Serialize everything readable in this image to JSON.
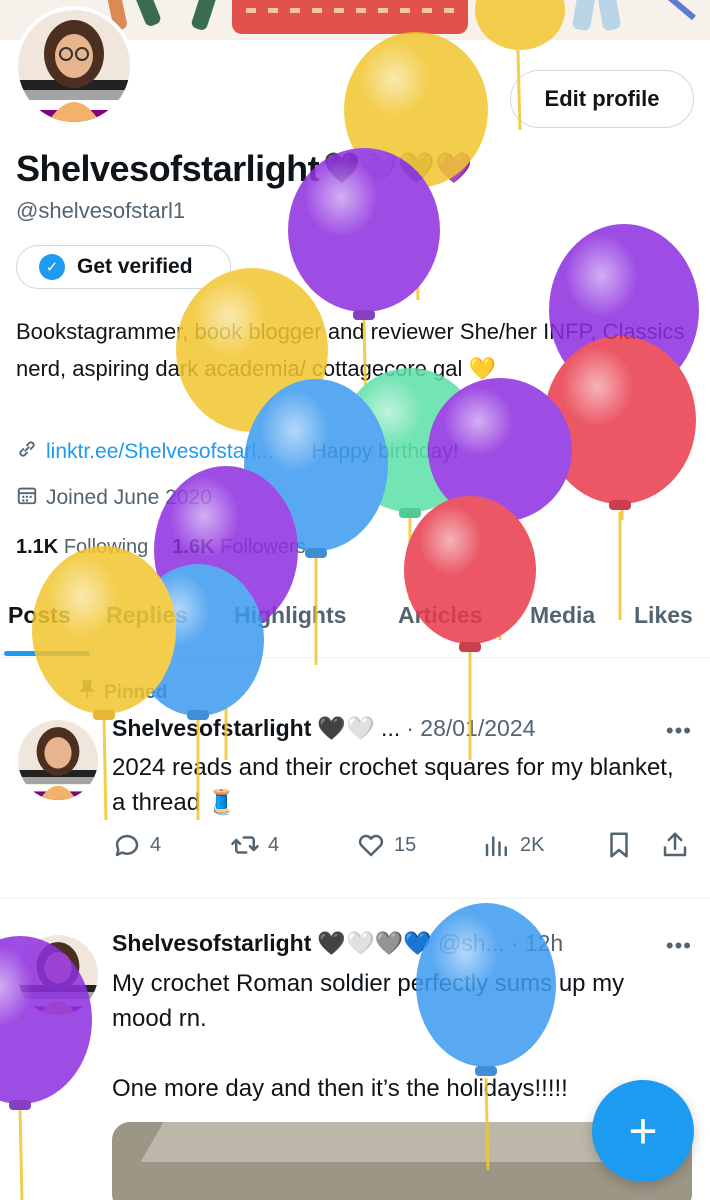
{
  "profile": {
    "name": "Shelvesofstarlight",
    "name_emojis": "🖤🤍🩶💜",
    "handle": "@shelvesofstarl1",
    "edit_label": "Edit profile",
    "verify_label": "Get verified",
    "bio": "Bookstagrammer, book blogger and reviewer She/her INFP, Classics nerd, aspiring dark academia/ cottagecore gal 💛",
    "link": "linktr.ee/Shelvesofstarl...",
    "birthday": "Happy birthday!",
    "joined": "Joined June 2020",
    "following_count": "1.1K",
    "following_label": "Following",
    "followers_count": "1.6K",
    "followers_label": "Followers"
  },
  "tabs": [
    "Posts",
    "Replies",
    "Highlights",
    "Articles",
    "Media",
    "Likes"
  ],
  "pinned_label": "Pinned",
  "posts": [
    {
      "name": "Shelvesofstarlight",
      "emojis": "🖤🤍 ...",
      "time": "· 28/01/2024",
      "text": "2024 reads and their crochet squares for my blanket, a thread 🧵",
      "replies": "4",
      "reposts": "4",
      "likes": "15",
      "views": "2K"
    },
    {
      "name": "Shelvesofstarlight",
      "emojis": "🖤🤍🩶💙",
      "handle": "@sh...",
      "time": "· 12h",
      "text": "My crochet Roman soldier perfectly sums up my mood rn.\n\nOne more day and then it’s the holidays!!!!!"
    }
  ],
  "fab_label": "+",
  "colors": {
    "accent": "#1d9bf0",
    "text": "#0f1419",
    "secondary": "#536471",
    "balloon_yellow": "#f2c62f",
    "balloon_purple": "#8e2fe0",
    "balloon_blue": "#3d9af0",
    "balloon_green": "#5be0a8",
    "balloon_red": "#e83a4a"
  }
}
